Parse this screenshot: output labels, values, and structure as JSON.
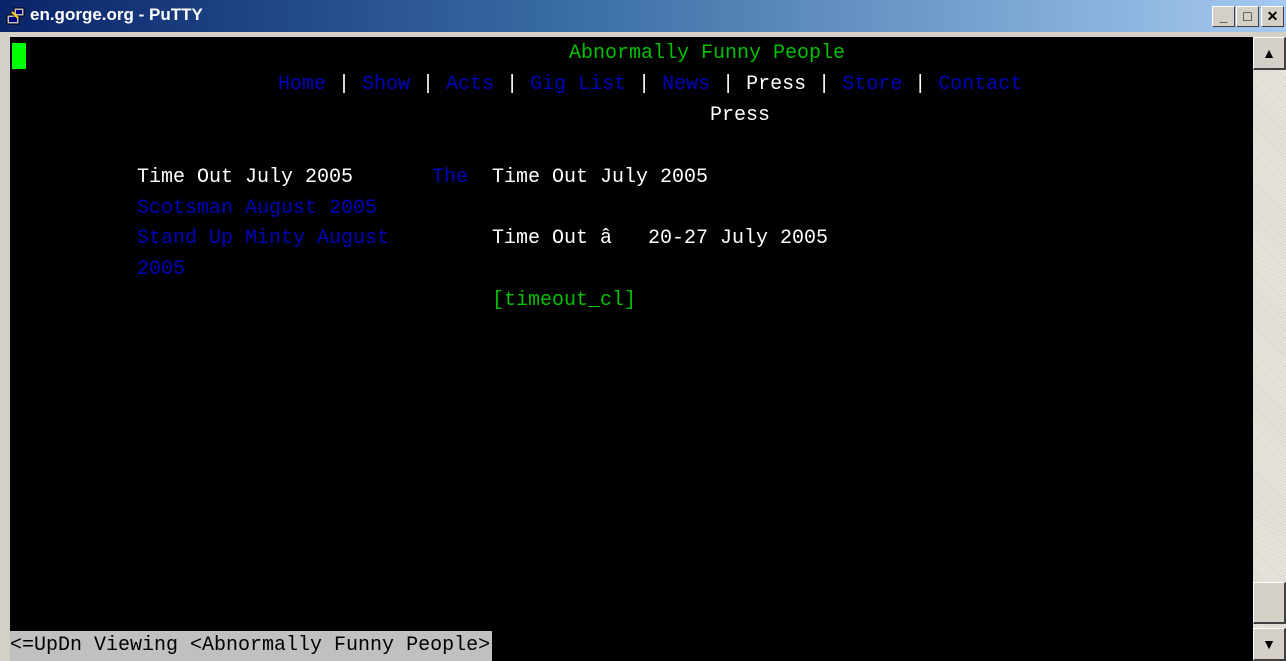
{
  "window": {
    "title": "en.gorge.org - PuTTY",
    "minimize": "_",
    "maximize": "□",
    "close": "✕"
  },
  "terminal": {
    "site_title": "Abnormally Funny People",
    "nav": {
      "home": "Home",
      "show": "Show",
      "acts": "Acts",
      "gig_list": "Gig List",
      "news": "News",
      "press": "Press",
      "store": "Store",
      "contact": "Contact",
      "separator": " | "
    },
    "page_heading": "Press",
    "left_links": {
      "item1": "Time Out July 2005",
      "item2_line1": "The",
      "item2_line2": "Scotsman August 2005",
      "item3_line1": "Stand Up Minty August",
      "item3_line2": "2005"
    },
    "article": {
      "title": "Time Out July 2005",
      "subtitle": "Time Out â   20-27 July 2005",
      "image_link": "[timeout_cl]"
    },
    "status_bar": "<=UpDn Viewing <Abnormally Funny People>"
  },
  "scrollbar": {
    "up_arrow": "▲",
    "down_arrow": "▼"
  },
  "colors": {
    "terminal_bg": "#000000",
    "text": "#ffffff",
    "green": "#00c000",
    "link_blue": "#0000bb",
    "status_bg": "#c0c0c0"
  }
}
